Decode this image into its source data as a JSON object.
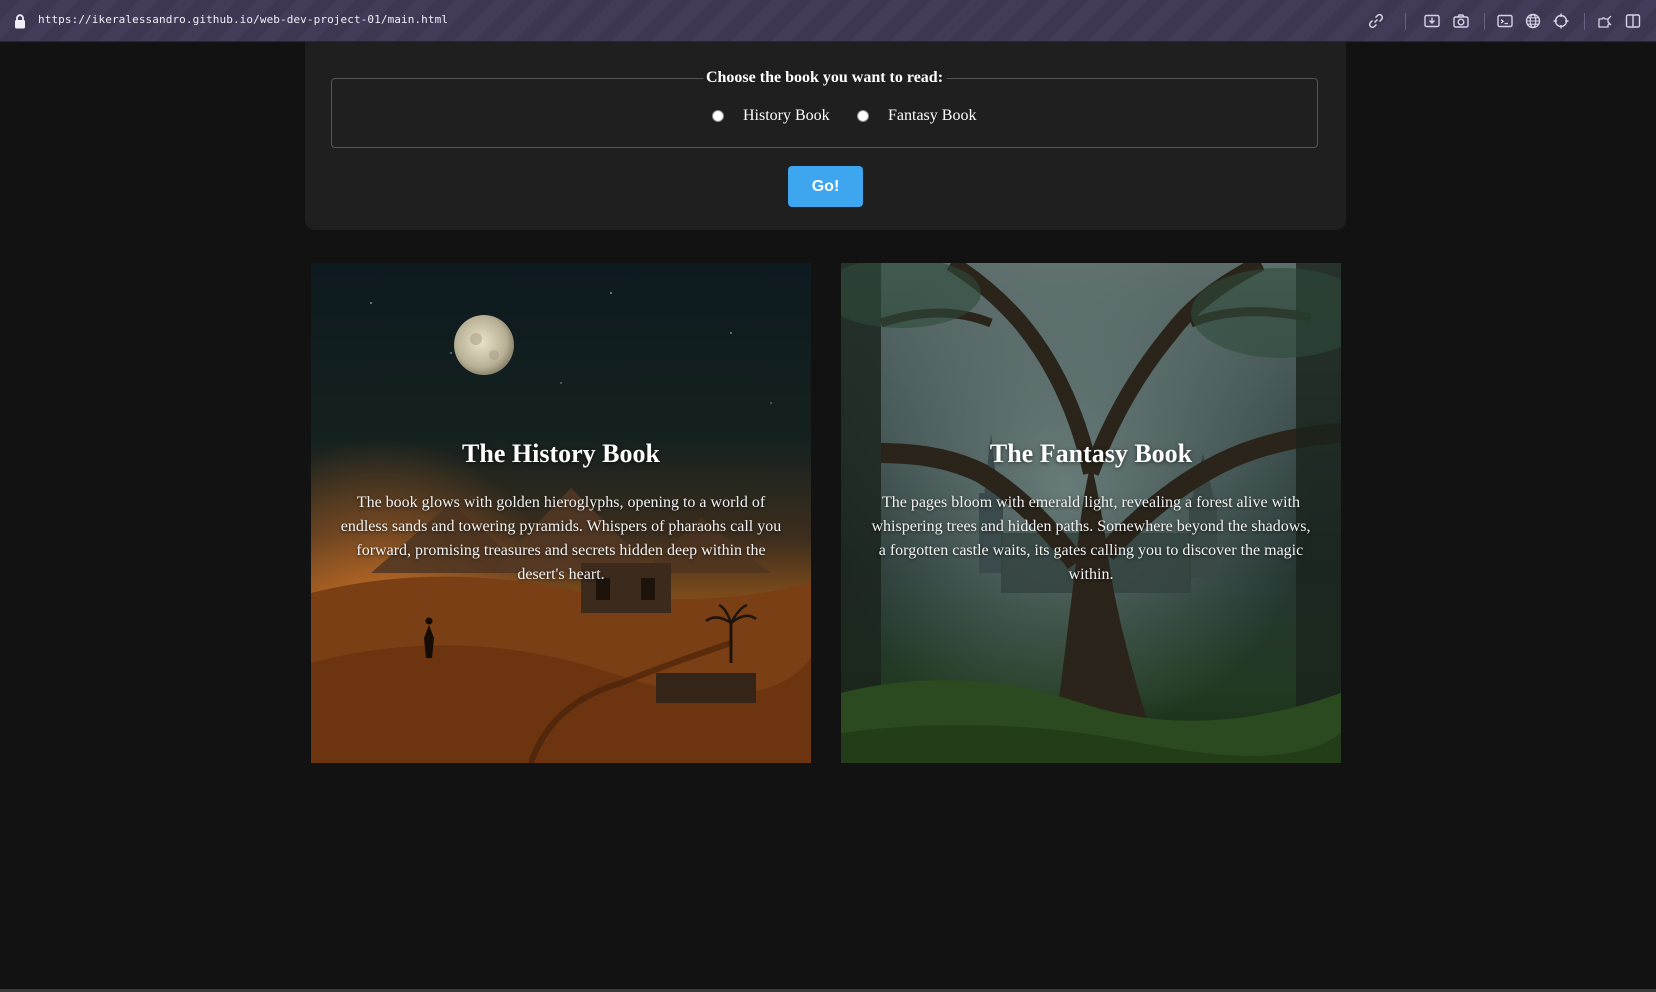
{
  "browser": {
    "url": "https://ikeralessandro.github.io/web-dev-project-01/main.html",
    "toolbar_icons": [
      "link-icon",
      "download-icon",
      "camera-icon",
      "terminal-icon",
      "globe-icon",
      "crosshair-icon",
      "extensions-icon",
      "sidebar-icon"
    ]
  },
  "form": {
    "legend": "Choose the book you want to read:",
    "options": [
      {
        "label": "History Book",
        "checked": false
      },
      {
        "label": "Fantasy Book",
        "checked": false
      }
    ],
    "submit_label": "Go!"
  },
  "cards": [
    {
      "title": "The History Book",
      "text": "The book glows with golden hieroglyphs, opening to a world of endless sands and towering pyramids. Whispers of pharaohs call you forward, promising treasures and secrets hidden deep within the desert's heart."
    },
    {
      "title": "The Fantasy Book",
      "text": "The pages bloom with emerald light, revealing a forest alive with whispering trees and hidden paths. Somewhere beyond the shadows, a forgotten castle waits, its gates calling you to discover the magic within."
    }
  ],
  "colors": {
    "page_background": "#121212",
    "panel_background": "#1f1f1f",
    "button_accent": "#3ea6ee",
    "browser_bar": "#3f3752"
  }
}
